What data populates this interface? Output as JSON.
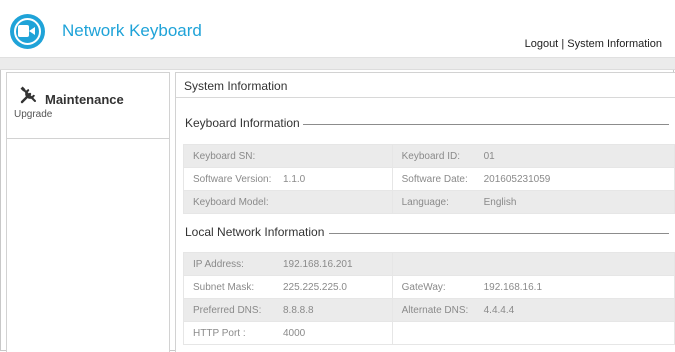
{
  "header": {
    "app_title": "Network Keyboard",
    "logout_label": "Logout",
    "separator": "|",
    "system_info_label": "System Information",
    "accent_color": "#1fa3d8"
  },
  "sidebar": {
    "heading": "Maintenance",
    "heading_icon": "tools-icon",
    "items": [
      {
        "label": "Upgrade"
      }
    ]
  },
  "main": {
    "title": "System Information",
    "keyboard_section": {
      "heading": "Keyboard Information",
      "rows": [
        {
          "left_label": "Keyboard SN:",
          "left_value": "",
          "right_label": "Keyboard ID:",
          "right_value": "01"
        },
        {
          "left_label": "Software Version:",
          "left_value": "1.1.0",
          "right_label": "Software Date:",
          "right_value": "201605231059"
        },
        {
          "left_label": "Keyboard Model:",
          "left_value": "",
          "right_label": "Language:",
          "right_value": "English"
        }
      ]
    },
    "network_section": {
      "heading": "Local Network Information",
      "rows": [
        {
          "left_label": "IP Address:",
          "left_value": "192.168.16.201",
          "right_label": "",
          "right_value": ""
        },
        {
          "left_label": "Subnet Mask:",
          "left_value": "225.225.225.0",
          "right_label": "GateWay:",
          "right_value": "192.168.16.1"
        },
        {
          "left_label": "Preferred DNS:",
          "left_value": "8.8.8.8",
          "right_label": "Alternate DNS:",
          "right_value": "4.4.4.4"
        },
        {
          "left_label": "HTTP Port :",
          "left_value": "4000",
          "right_label": "",
          "right_value": ""
        }
      ]
    }
  }
}
